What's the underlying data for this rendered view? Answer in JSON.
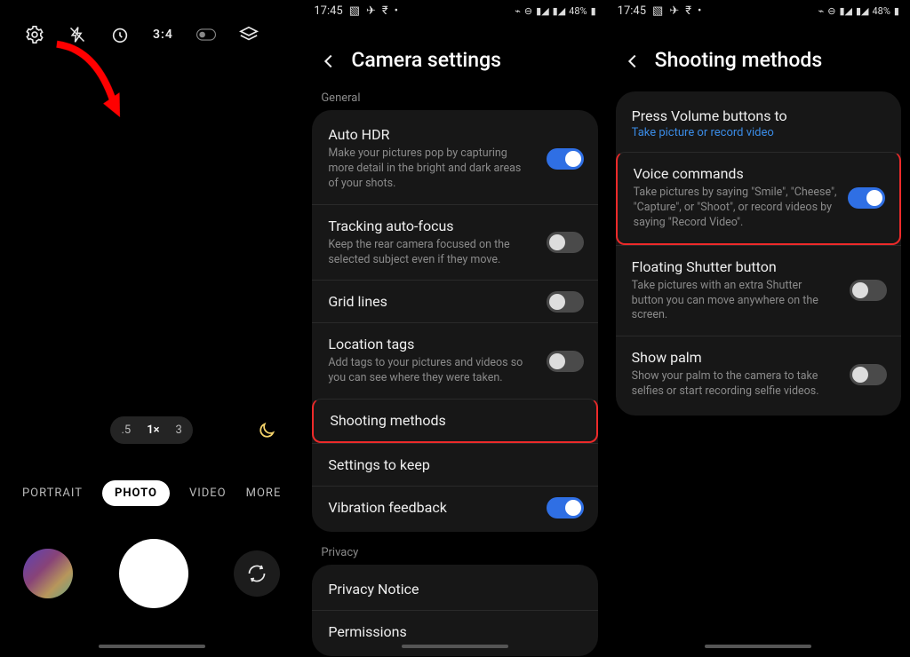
{
  "status": {
    "time": "17:45",
    "battery": "48%"
  },
  "pane1": {
    "ratio": "3:4",
    "zoom": {
      "a": ".5",
      "b": "1×",
      "c": "3"
    },
    "modes": {
      "portrait": "PORTRAIT",
      "photo": "PHOTO",
      "video": "VIDEO",
      "more": "MORE"
    }
  },
  "pane2": {
    "title": "Camera settings",
    "section_general": "General",
    "section_privacy": "Privacy",
    "rows": {
      "autohdr": {
        "title": "Auto HDR",
        "sub": "Make your pictures pop by capturing more detail in the bright and dark areas of your shots."
      },
      "tracking": {
        "title": "Tracking auto-focus",
        "sub": "Keep the rear camera focused on the selected subject even if they move."
      },
      "grid": {
        "title": "Grid lines"
      },
      "location": {
        "title": "Location tags",
        "sub": "Add tags to your pictures and videos so you can see where they were taken."
      },
      "shooting": {
        "title": "Shooting methods"
      },
      "keep": {
        "title": "Settings to keep"
      },
      "vibration": {
        "title": "Vibration feedback"
      },
      "privacy_notice": {
        "title": "Privacy Notice"
      },
      "permissions": {
        "title": "Permissions"
      }
    }
  },
  "pane3": {
    "title": "Shooting methods",
    "rows": {
      "volume": {
        "title": "Press Volume buttons to",
        "link": "Take picture or record video"
      },
      "voice": {
        "title": "Voice commands",
        "sub": "Take pictures by saying \"Smile\", \"Cheese\", \"Capture\", or \"Shoot\", or record videos by saying \"Record Video\"."
      },
      "floating": {
        "title": "Floating Shutter button",
        "sub": "Take pictures with an extra Shutter button you can move anywhere on the screen."
      },
      "palm": {
        "title": "Show palm",
        "sub": "Show your palm to the camera to take selfies or start recording selfie videos."
      }
    }
  }
}
